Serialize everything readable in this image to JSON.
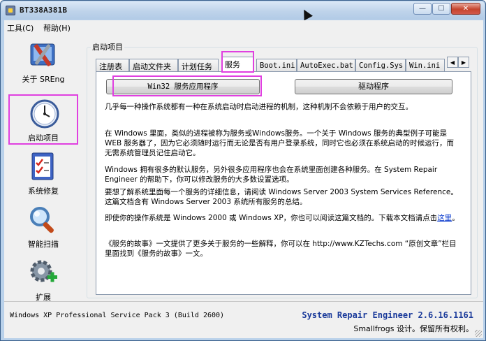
{
  "window": {
    "title": "BT338A381B",
    "minimize": "—",
    "maximize": "☐",
    "close": "✕"
  },
  "menu": {
    "tools": "工具(C)",
    "help": "帮助(H)"
  },
  "nav": [
    {
      "label": "关于 SREng",
      "icon": "tools-icon"
    },
    {
      "label": "启动项目",
      "icon": "clock-icon"
    },
    {
      "label": "系统修复",
      "icon": "checklist-icon"
    },
    {
      "label": "智能扫描",
      "icon": "magnifier-icon"
    },
    {
      "label": "扩展",
      "icon": "gear-plus-icon"
    }
  ],
  "group_title": "启动项目",
  "tabs": [
    "注册表",
    "启动文件夹",
    "计划任务",
    "服务",
    "Boot.ini",
    "AutoExec.bat",
    "Config.Sys",
    "Win.ini"
  ],
  "tab_scroll": {
    "left": "◀",
    "right": "▶"
  },
  "buttons": {
    "win32": "Win32 服务应用程序",
    "driver": "驱动程序"
  },
  "paragraphs": {
    "p1": "几乎每一种操作系统都有一种在系统启动时启动进程的机制，这种机制不会依赖于用户的交互。",
    "p2": "在 Windows 里面，类似的进程被称为服务或Windows服务。一个关于 Windows 服务的典型例子可能是 WEB 服务器了，因为它必须随时运行而无论是否有用户登录系统，同时它也必须在系统启动的时候运行，而无需系统管理员记住启动它。",
    "p3": "Windows 拥有很多的默认服务，另外很多应用程序也会在系统里面创建各种服务。在 System Repair Engineer 的帮助下，你可以修改服务的大多数设置选项。",
    "p4": "要想了解系统里面每一个服务的详细信息，请阅读 Windows Server 2003 System Services Reference。这篇文档含有 Windows Server 2003 系统所有服务的总结。",
    "p5a": "即使你的操作系统是 Windows 2000 或 Windows XP，你也可以阅读这篇文档的。下载本文档请点击",
    "p5link": "这里",
    "p5b": "。",
    "p6": "《服务的故事》一文提供了更多关于服务的一些解释，你可以在 http://www.KZTechs.com “原创文章”栏目里面找到《服务的故事》一文。"
  },
  "status": {
    "os": "Windows XP Professional Service Pack 3 (Build 2600)",
    "product": "System Repair Engineer 2.6.16.1161",
    "copyright": "Smallfrogs 设计。保留所有权利。"
  }
}
